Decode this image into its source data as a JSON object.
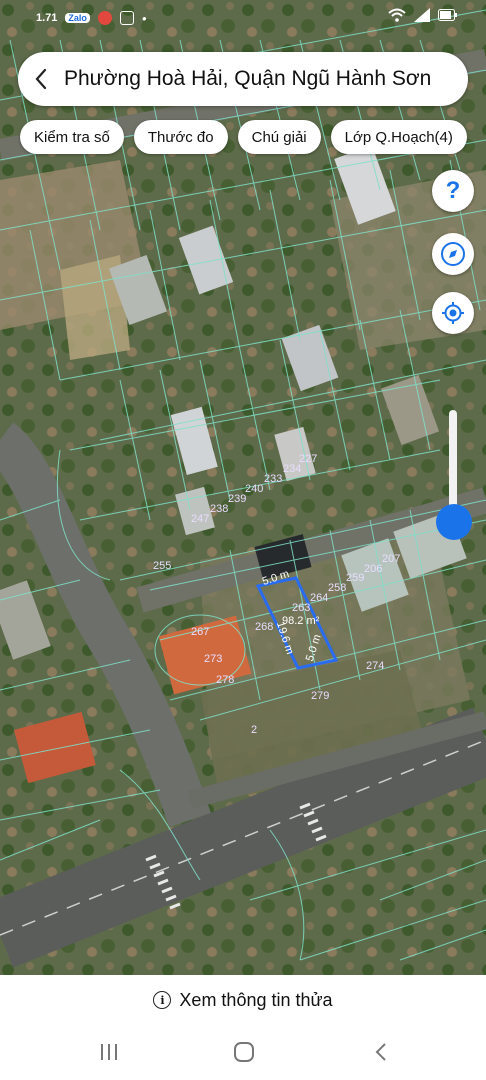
{
  "status_bar": {
    "left_text": "1.71",
    "app_badge": "Zalo",
    "dot": "•"
  },
  "header": {
    "back_icon": "chevron-left-icon",
    "title": "Phường Hoà Hải, Quận Ngũ Hành Sơn"
  },
  "chips": [
    {
      "label": "Kiểm tra số"
    },
    {
      "label": "Thước đo"
    },
    {
      "label": "Chú giải"
    },
    {
      "label": "Lớp Q.Hoạch(4)"
    }
  ],
  "fabs": {
    "help_icon": "help-icon",
    "compass_icon": "compass-icon",
    "location_icon": "my-location-icon",
    "help_label": "?"
  },
  "opacity_slider": {
    "level": 0.2
  },
  "map": {
    "lot_numbers": [
      "227",
      "234",
      "233",
      "240",
      "239",
      "238",
      "247",
      "255",
      "207",
      "206",
      "259",
      "258",
      "264",
      "263",
      "267",
      "268",
      "273",
      "278",
      "274",
      "279",
      "2"
    ],
    "selected_lot": {
      "width_top": "5.0 m",
      "area": "98.2 m²",
      "length_left": "19.6 m",
      "width_bottom": "5.0 m"
    }
  },
  "bottom_panel": {
    "info_label": "Xem thông tin thửa",
    "info_icon": "info-icon"
  },
  "nav_bar": {
    "recent_icon": "recent-apps-icon",
    "home_icon": "home-icon",
    "back_icon": "back-icon"
  }
}
